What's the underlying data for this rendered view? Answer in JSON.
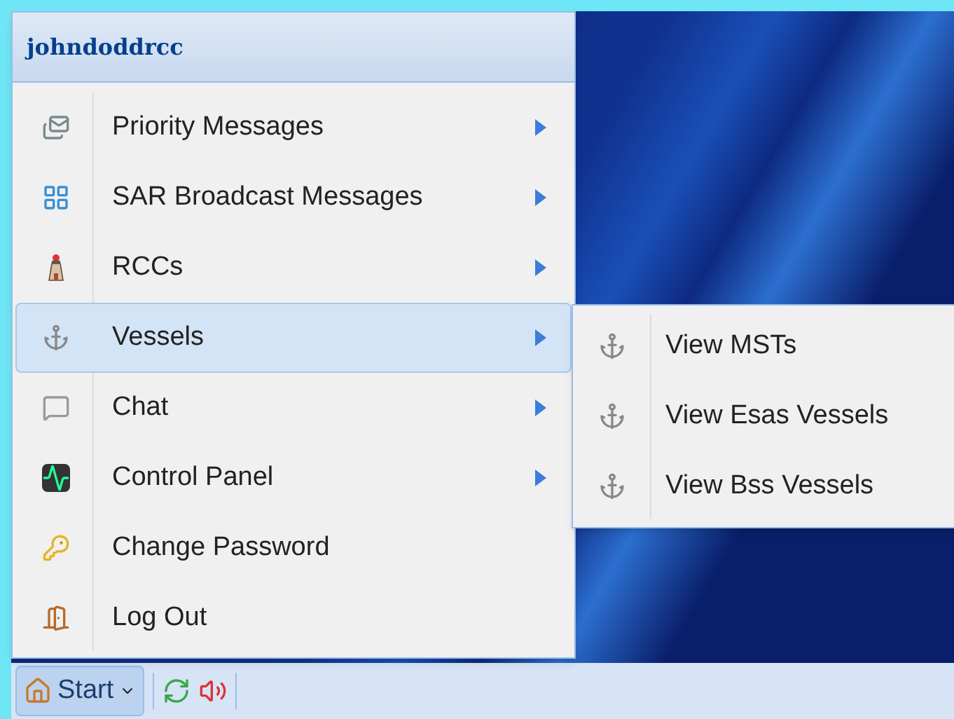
{
  "menu": {
    "title": "johndoddrcc",
    "items": [
      {
        "label": "Priority Messages",
        "submenu": true,
        "selected": false
      },
      {
        "label": "SAR Broadcast Messages",
        "submenu": true,
        "selected": false
      },
      {
        "label": "RCCs",
        "submenu": true,
        "selected": false
      },
      {
        "label": "Vessels",
        "submenu": true,
        "selected": true
      },
      {
        "label": "Chat",
        "submenu": true,
        "selected": false
      },
      {
        "label": "Control Panel",
        "submenu": true,
        "selected": false
      },
      {
        "label": "Change Password",
        "submenu": false,
        "selected": false
      },
      {
        "label": "Log Out",
        "submenu": false,
        "selected": false
      }
    ]
  },
  "submenu": {
    "items": [
      {
        "label": "View MSTs"
      },
      {
        "label": "View Esas Vessels"
      },
      {
        "label": "View Bss Vessels"
      }
    ]
  },
  "taskbar": {
    "start": "Start"
  }
}
